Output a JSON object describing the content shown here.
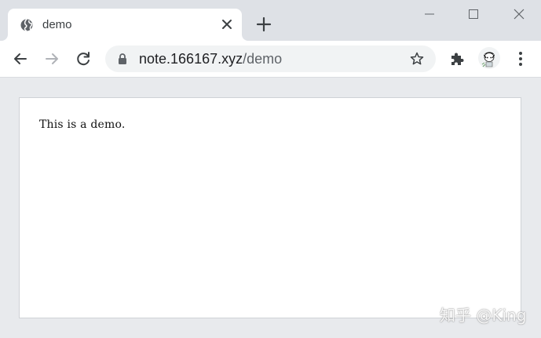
{
  "tab": {
    "title": "demo",
    "favicon": "globe-icon"
  },
  "toolbar": {
    "url_host": "note.166167.xyz",
    "url_path": "/demo"
  },
  "page": {
    "text": "This is a demo."
  },
  "watermark": {
    "text": "知乎 @King"
  },
  "colors": {
    "tab_strip": "#dee1e6",
    "omnibox": "#f1f3f4",
    "page_bg": "#e8eaed"
  }
}
